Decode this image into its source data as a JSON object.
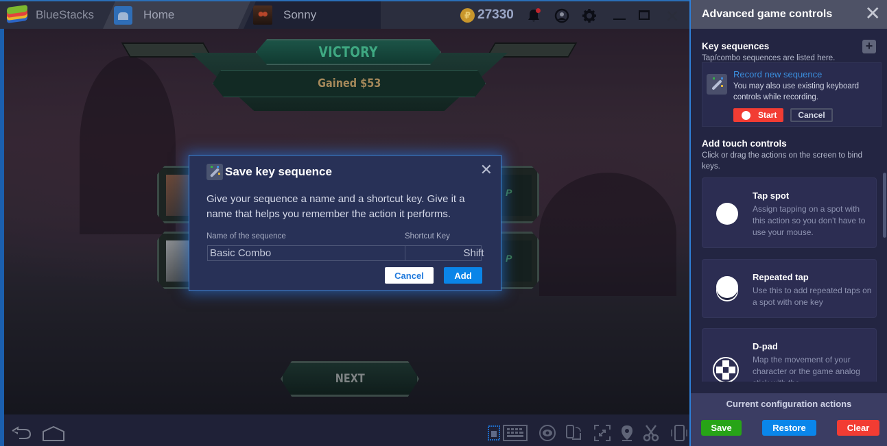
{
  "titlebar": {
    "app_name": "BlueStacks",
    "tabs": [
      {
        "label": "Home",
        "icon": "home-icon"
      },
      {
        "label": "Sonny",
        "icon": "game-avatar-icon"
      }
    ],
    "coin_symbol": "₽",
    "coins": "27330",
    "icons": [
      "bell-icon",
      "account-icon",
      "gear-icon",
      "minimize-icon",
      "maximize-icon",
      "close-icon"
    ],
    "colors": {
      "notification_dot": "#c0262d",
      "accent": "#2a6fb8"
    }
  },
  "game": {
    "banner_title": "VICTORY",
    "banner_subtitle": "Gained $53",
    "reward_letter": "P",
    "next_label": "NEXT"
  },
  "modal": {
    "title": "Save key sequence",
    "close_glyph": "✕",
    "description": "Give your sequence a name and a shortcut key. Give it a name that helps you remember the action it performs.",
    "name_label": "Name of the sequence",
    "key_label": "Shortcut Key",
    "name_value": "Basic Combo",
    "key_value": "Shift",
    "cancel_label": "Cancel",
    "add_label": "Add"
  },
  "bottombar": {
    "icons": [
      "back-icon",
      "android-home-icon",
      "keyboard-toggle-icon",
      "keyboard-icon",
      "eye-icon",
      "rotate-icon",
      "fullscreen-icon",
      "location-icon",
      "scissors-icon",
      "shake-icon"
    ]
  },
  "panel": {
    "title": "Advanced game controls",
    "close_glyph": "✕",
    "key_sequences": {
      "title": "Key sequences",
      "subtitle": "Tap/combo sequences are listed here.",
      "add_glyph": "+",
      "record_link": "Record new sequence",
      "record_desc": "You may also use existing keyboard controls while recording.",
      "start_label": "Start",
      "cancel_label": "Cancel"
    },
    "touch_controls": {
      "title": "Add touch controls",
      "subtitle": "Click or drag the actions on the screen to bind keys.",
      "items": [
        {
          "title": "Tap spot",
          "desc": "Assign tapping on a spot with this action so you don't have to use your mouse.",
          "icon": "tap-spot-icon"
        },
        {
          "title": "Repeated tap",
          "desc": "Use this to add repeated taps on a spot with one key",
          "icon": "repeated-tap-icon"
        },
        {
          "title": "D-pad",
          "desc": "Map the movement of your character or the game analog stick with the",
          "icon": "dpad-icon"
        }
      ]
    },
    "footer": {
      "title": "Current configuration actions",
      "save_label": "Save",
      "restore_label": "Restore",
      "clear_label": "Clear",
      "colors": {
        "save": "#27a417",
        "restore": "#0a86ea",
        "clear": "#f23c33"
      }
    }
  }
}
